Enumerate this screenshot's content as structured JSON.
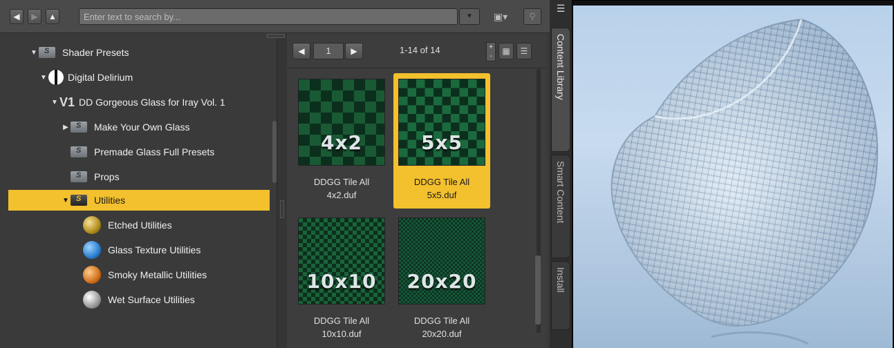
{
  "toolbar": {
    "search_placeholder": "Enter text to search by..."
  },
  "tree": {
    "items": [
      {
        "label": "Shader Presets",
        "level": 2,
        "expanded": true
      },
      {
        "label": "Digital Delirium",
        "level": 3,
        "expanded": true
      },
      {
        "label": "DD Gorgeous Glass for Iray Vol. 1",
        "level": 4,
        "expanded": true,
        "badge": "V1"
      },
      {
        "label": "Make Your Own Glass",
        "level": 5,
        "expanded": false
      },
      {
        "label": "Premade Glass Full Presets",
        "level": 5
      },
      {
        "label": "Props",
        "level": 5
      },
      {
        "label": "Utilities",
        "level": 5,
        "expanded": true,
        "selected": true
      },
      {
        "label": "Etched Utilities",
        "level": 6,
        "icon": "gold-ball-icon"
      },
      {
        "label": "Glass Texture Utilities",
        "level": 6,
        "icon": "blue-ball-icon"
      },
      {
        "label": "Smoky Metallic Utilities",
        "level": 6,
        "icon": "orange-ball-icon"
      },
      {
        "label": "Wet Surface Utilities",
        "level": 6,
        "icon": "silver-ball-icon"
      }
    ]
  },
  "pager": {
    "page": "1",
    "count": "1-14 of 14"
  },
  "tiles": [
    {
      "size": "4x2",
      "label1": "DDGG Tile All",
      "label2": "4x2.duf",
      "selected": false
    },
    {
      "size": "5x5",
      "label1": "DDGG Tile All",
      "label2": "5x5.duf",
      "selected": true
    },
    {
      "size": "10x10",
      "label1": "DDGG Tile All",
      "label2": "10x10.duf",
      "selected": false
    },
    {
      "size": "20x20",
      "label1": "DDGG Tile All",
      "label2": "20x20.duf",
      "selected": false
    }
  ],
  "side_tabs": {
    "content_library": "Content Library",
    "smart_content": "Smart Content",
    "install": "Install"
  },
  "colors": {
    "selection": "#f3c02e",
    "panel": "#3a3a3a",
    "tile_green": "#0e3a24"
  }
}
